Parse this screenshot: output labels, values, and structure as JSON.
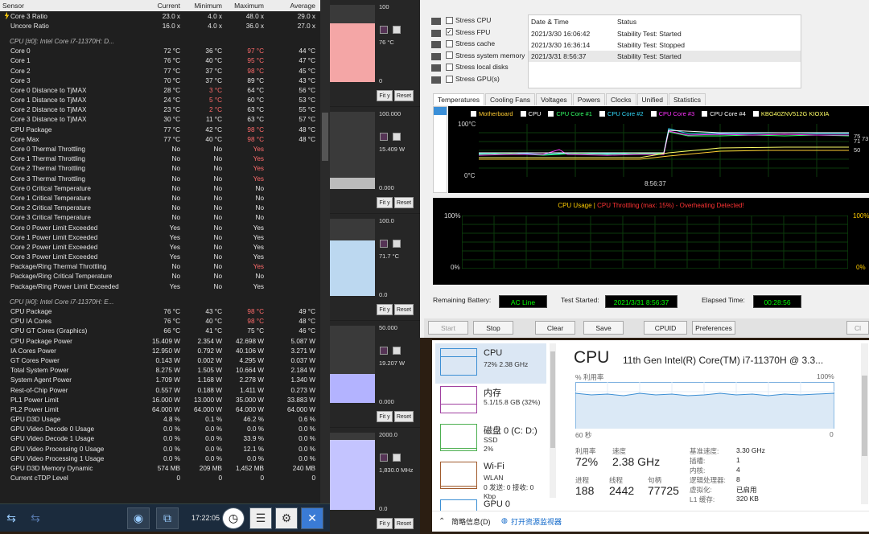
{
  "hwinfo": {
    "headers": [
      "Sensor",
      "Current",
      "Minimum",
      "Maximum",
      "Average"
    ],
    "rows": [
      {
        "t": "r",
        "n": "Core 3 Ratio",
        "v": [
          "23.0 x",
          "4.0 x",
          "48.0 x",
          "29.0 x"
        ]
      },
      {
        "t": "r",
        "n": "Uncore Ratio",
        "v": [
          "16.0 x",
          "4.0 x",
          "36.0 x",
          "27.0 x"
        ]
      },
      {
        "t": "s"
      },
      {
        "t": "g",
        "n": "CPU [#0]: Intel Core i7-11370H: D..."
      },
      {
        "t": "r",
        "n": "Core 0",
        "v": [
          "72 °C",
          "36 °C",
          "97 °C",
          "44 °C"
        ],
        "r": [
          2
        ]
      },
      {
        "t": "r",
        "n": "Core 1",
        "v": [
          "76 °C",
          "40 °C",
          "95 °C",
          "47 °C"
        ],
        "r": [
          2
        ]
      },
      {
        "t": "r",
        "n": "Core 2",
        "v": [
          "77 °C",
          "37 °C",
          "98 °C",
          "45 °C"
        ],
        "r": [
          2
        ]
      },
      {
        "t": "r",
        "n": "Core 3",
        "v": [
          "70 °C",
          "37 °C",
          "89 °C",
          "43 °C"
        ]
      },
      {
        "t": "r",
        "n": "Core 0 Distance to TjMAX",
        "v": [
          "28 °C",
          "3 °C",
          "64 °C",
          "56 °C"
        ],
        "r": [
          1
        ]
      },
      {
        "t": "r",
        "n": "Core 1 Distance to TjMAX",
        "v": [
          "24 °C",
          "5 °C",
          "60 °C",
          "53 °C"
        ],
        "r": [
          1
        ]
      },
      {
        "t": "r",
        "n": "Core 2 Distance to TjMAX",
        "v": [
          "23 °C",
          "2 °C",
          "63 °C",
          "55 °C"
        ],
        "r": [
          1
        ]
      },
      {
        "t": "r",
        "n": "Core 3 Distance to TjMAX",
        "v": [
          "30 °C",
          "11 °C",
          "63 °C",
          "57 °C"
        ]
      },
      {
        "t": "r",
        "n": "CPU Package",
        "v": [
          "77 °C",
          "42 °C",
          "98 °C",
          "48 °C"
        ],
        "r": [
          2
        ]
      },
      {
        "t": "r",
        "n": "Core Max",
        "v": [
          "77 °C",
          "40 °C",
          "98 °C",
          "48 °C"
        ],
        "r": [
          2
        ]
      },
      {
        "t": "r",
        "n": "Core 0 Thermal Throttling",
        "v": [
          "No",
          "No",
          "Yes",
          ""
        ],
        "r": [
          2
        ]
      },
      {
        "t": "r",
        "n": "Core 1 Thermal Throttling",
        "v": [
          "No",
          "No",
          "Yes",
          ""
        ],
        "r": [
          2
        ]
      },
      {
        "t": "r",
        "n": "Core 2 Thermal Throttling",
        "v": [
          "No",
          "No",
          "Yes",
          ""
        ],
        "r": [
          2
        ]
      },
      {
        "t": "r",
        "n": "Core 3 Thermal Throttling",
        "v": [
          "No",
          "No",
          "Yes",
          ""
        ],
        "r": [
          2
        ]
      },
      {
        "t": "r",
        "n": "Core 0 Critical Temperature",
        "v": [
          "No",
          "No",
          "No",
          ""
        ]
      },
      {
        "t": "r",
        "n": "Core 1 Critical Temperature",
        "v": [
          "No",
          "No",
          "No",
          ""
        ]
      },
      {
        "t": "r",
        "n": "Core 2 Critical Temperature",
        "v": [
          "No",
          "No",
          "No",
          ""
        ]
      },
      {
        "t": "r",
        "n": "Core 3 Critical Temperature",
        "v": [
          "No",
          "No",
          "No",
          ""
        ]
      },
      {
        "t": "r",
        "n": "Core 0 Power Limit Exceeded",
        "v": [
          "Yes",
          "No",
          "Yes",
          ""
        ]
      },
      {
        "t": "r",
        "n": "Core 1 Power Limit Exceeded",
        "v": [
          "Yes",
          "No",
          "Yes",
          ""
        ]
      },
      {
        "t": "r",
        "n": "Core 2 Power Limit Exceeded",
        "v": [
          "Yes",
          "No",
          "Yes",
          ""
        ]
      },
      {
        "t": "r",
        "n": "Core 3 Power Limit Exceeded",
        "v": [
          "Yes",
          "No",
          "Yes",
          ""
        ]
      },
      {
        "t": "r",
        "n": "Package/Ring Thermal Throttling",
        "v": [
          "No",
          "No",
          "Yes",
          ""
        ],
        "r": [
          2
        ]
      },
      {
        "t": "r",
        "n": "Package/Ring Critical Temperature",
        "v": [
          "No",
          "No",
          "No",
          ""
        ]
      },
      {
        "t": "r",
        "n": "Package/Ring Power Limit Exceeded",
        "v": [
          "Yes",
          "No",
          "Yes",
          ""
        ]
      },
      {
        "t": "s"
      },
      {
        "t": "g",
        "n": "CPU [#0]: Intel Core i7-11370H: E..."
      },
      {
        "t": "r",
        "n": "CPU Package",
        "v": [
          "76 °C",
          "43 °C",
          "98 °C",
          "49 °C"
        ],
        "r": [
          2
        ]
      },
      {
        "t": "r",
        "n": "CPU IA Cores",
        "v": [
          "76 °C",
          "40 °C",
          "98 °C",
          "48 °C"
        ],
        "r": [
          2
        ]
      },
      {
        "t": "r",
        "n": "CPU GT Cores (Graphics)",
        "v": [
          "66 °C",
          "41 °C",
          "75 °C",
          "46 °C"
        ]
      },
      {
        "t": "r",
        "n": "CPU Package Power",
        "v": [
          "15.409 W",
          "2.354 W",
          "42.698 W",
          "5.087 W"
        ],
        "b": true
      },
      {
        "t": "r",
        "n": "IA Cores Power",
        "v": [
          "12.950 W",
          "0.792 W",
          "40.106 W",
          "3.271 W"
        ],
        "b": true
      },
      {
        "t": "r",
        "n": "GT Cores Power",
        "v": [
          "0.143 W",
          "0.002 W",
          "4.295 W",
          "0.037 W"
        ],
        "b": true
      },
      {
        "t": "r",
        "n": "Total System Power",
        "v": [
          "8.275 W",
          "1.505 W",
          "10.664 W",
          "2.184 W"
        ],
        "b": true
      },
      {
        "t": "r",
        "n": "System Agent Power",
        "v": [
          "1.709 W",
          "1.168 W",
          "2.278 W",
          "1.340 W"
        ],
        "b": true
      },
      {
        "t": "r",
        "n": "Rest-of-Chip Power",
        "v": [
          "0.557 W",
          "0.188 W",
          "1.411 W",
          "0.273 W"
        ],
        "b": true
      },
      {
        "t": "r",
        "n": "PL1 Power Limit",
        "v": [
          "16.000 W",
          "13.000 W",
          "35.000 W",
          "33.883 W"
        ],
        "b": true
      },
      {
        "t": "r",
        "n": "PL2 Power Limit",
        "v": [
          "64.000 W",
          "64.000 W",
          "64.000 W",
          "64.000 W"
        ],
        "b": true
      },
      {
        "t": "r",
        "n": "GPU D3D Usage",
        "v": [
          "4.8 %",
          "0.1 %",
          "46.2 %",
          "0.6 %"
        ]
      },
      {
        "t": "r",
        "n": "GPU Video Decode 0 Usage",
        "v": [
          "0.0 %",
          "0.0 %",
          "0.0 %",
          "0.0 %"
        ]
      },
      {
        "t": "r",
        "n": "GPU Video Decode 1 Usage",
        "v": [
          "0.0 %",
          "0.0 %",
          "33.9 %",
          "0.0 %"
        ]
      },
      {
        "t": "r",
        "n": "GPU Video Processing 0 Usage",
        "v": [
          "0.0 %",
          "0.0 %",
          "12.1 %",
          "0.0 %"
        ]
      },
      {
        "t": "r",
        "n": "GPU Video Processing 1 Usage",
        "v": [
          "0.0 %",
          "0.0 %",
          "0.0 %",
          "0.0 %"
        ]
      },
      {
        "t": "r",
        "n": "GPU D3D Memory Dynamic",
        "v": [
          "574 MB",
          "209 MB",
          "1,452 MB",
          "240 MB"
        ]
      },
      {
        "t": "r",
        "n": "Current cTDP Level",
        "v": [
          "0",
          "0",
          "0",
          "0"
        ]
      }
    ],
    "clock": "17:22:05"
  },
  "graphs": [
    {
      "max": "100",
      "val": "76 °C",
      "min": "0",
      "color": "#f4a6a6",
      "fill": 0.76
    },
    {
      "max": "100.000",
      "val": "15.409 W",
      "min": "0.000",
      "color": "#bbbbbb",
      "fill": 0.15
    },
    {
      "max": "100.0",
      "val": "71.7 °C",
      "min": "0.0",
      "color": "#bcd8f0",
      "fill": 0.72
    },
    {
      "max": "50.000",
      "val": "19.207 W",
      "min": "0.000",
      "color": "#b3b3ff",
      "fill": 0.38
    },
    {
      "max": "2000.0",
      "val": "1,830.0 MHz",
      "min": "0.0",
      "color": "#c4c4ff",
      "fill": 0.91
    }
  ],
  "graph_btns": {
    "fit": "Fit y",
    "reset": "Reset"
  },
  "occt": {
    "checks": [
      {
        "label": "Stress CPU",
        "on": false
      },
      {
        "label": "Stress FPU",
        "on": true
      },
      {
        "label": "Stress cache",
        "on": false
      },
      {
        "label": "Stress system memory",
        "on": false
      },
      {
        "label": "Stress local disks",
        "on": false
      },
      {
        "label": "Stress GPU(s)",
        "on": false
      }
    ],
    "log_head": [
      "Date & Time",
      "Status"
    ],
    "log": [
      [
        "2021/3/30 16:06:42",
        "Stability Test: Started"
      ],
      [
        "2021/3/30 16:36:14",
        "Stability Test: Stopped"
      ],
      [
        "2021/3/31 8:56:37",
        "Stability Test: Started"
      ]
    ],
    "tabs": [
      "Temperatures",
      "Cooling Fans",
      "Voltages",
      "Powers",
      "Clocks",
      "Unified",
      "Statistics"
    ],
    "legend": [
      {
        "label": "Motherboard",
        "color": "#ffcc33"
      },
      {
        "label": "CPU",
        "color": "#ffffff"
      },
      {
        "label": "CPU Core #1",
        "color": "#33ff66"
      },
      {
        "label": "CPU Core #2",
        "color": "#33ddff"
      },
      {
        "label": "CPU Core #3",
        "color": "#ff33ff"
      },
      {
        "label": "CPU Core #4",
        "color": "#ffffff"
      },
      {
        "label": "KBG40ZNV512G KIOXIA",
        "color": "#ffff66"
      }
    ],
    "temp": {
      "ytop": "100°C",
      "ybot": "0°C",
      "xlab": "8:56:37",
      "r1": "75",
      "r2": "71",
      "r3": "73",
      "r4": "50"
    },
    "usage": {
      "label_a": "CPU Usage",
      "sep": " | ",
      "label_b": "CPU Throttling (max: 15%) - Overheating Detected!",
      "ytop": "100%",
      "ybot": "0%",
      "rtop": "100%",
      "rbot": "0%"
    },
    "status": {
      "battery_label": "Remaining Battery:",
      "battery": "AC Line",
      "started_label": "Test Started:",
      "started": "2021/3/31 8:56:37",
      "elapsed_label": "Elapsed Time:",
      "elapsed": "00:28:56"
    },
    "buttons": [
      "Start",
      "Stop",
      "Clear",
      "Save",
      "CPUID",
      "Preferences",
      "Cl"
    ]
  },
  "taskmgr": {
    "items": [
      {
        "title": "CPU",
        "sub": "72% 2.38 GHz",
        "color": "#3c8fd4"
      },
      {
        "title": "内存",
        "sub": "5.1/15.8 GB (32%)",
        "color": "#a040a0"
      },
      {
        "title": "磁盘 0 (C: D:)",
        "sub": "SSD",
        "sub2": "2%",
        "color": "#4caf50"
      },
      {
        "title": "Wi-Fi",
        "sub": "WLAN",
        "sub2": "0 发送: 0 接收: 0 Kbp",
        "color": "#a05a2c"
      },
      {
        "title": "GPU 0",
        "sub": "",
        "color": "#3c8fd4"
      }
    ],
    "cpu_title": "CPU",
    "cpu_name": "11th Gen Intel(R) Core(TM) i7-11370H @ 3.3...",
    "util_label": "% 利用率",
    "util_max": "100%",
    "time_left": "60 秒",
    "time_right": "0",
    "stats": {
      "util_l": "利用率",
      "util": "72%",
      "speed_l": "速度",
      "speed": "2.38 GHz",
      "proc_l": "进程",
      "proc": "188",
      "thr_l": "线程",
      "thr": "2442",
      "hnd_l": "句柄",
      "hnd": "77725"
    },
    "specs": [
      [
        "基准速度:",
        "3.30 GHz"
      ],
      [
        "插槽:",
        "1"
      ],
      [
        "内核:",
        "4"
      ],
      [
        "逻辑处理器:",
        "8"
      ],
      [
        "虚拟化:",
        "已启用"
      ],
      [
        "L1 缓存:",
        "320 KB"
      ]
    ],
    "footer_a": "简略信息(D)",
    "footer_b": "打开资源监视器"
  }
}
